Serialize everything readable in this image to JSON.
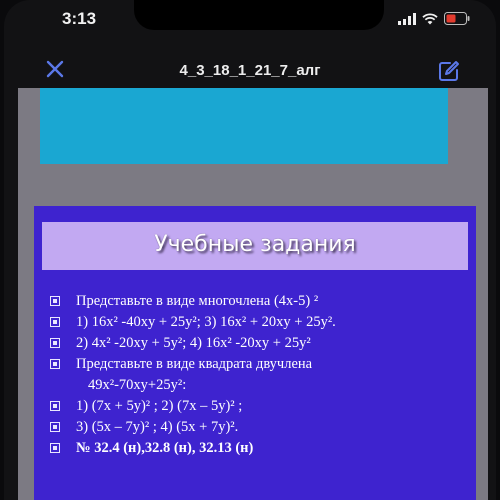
{
  "status_bar": {
    "time": "3:13"
  },
  "nav_bar": {
    "title": "4_3_18_1_21_7_алг"
  },
  "slide": {
    "title": "Учебные задания",
    "items": [
      {
        "text": "Представьте в виде многочлена (4х-5) ²",
        "bullet": true
      },
      {
        "text": "1) 16x² -40xy + 25y²; 3) 16x² + 20xy + 25y².",
        "bullet": true
      },
      {
        "text": "2) 4x² -20xy + 5y²; 4) 16x² -20xy + 25y²",
        "bullet": true
      },
      {
        "text": "Представьте в виде квадрата двучлена",
        "bullet": true
      },
      {
        "text": "49x²-70xy+25y²:",
        "bullet": false
      },
      {
        "text": "1) (7x + 5y)² ; 2) (7x – 5y)² ;",
        "bullet": true
      },
      {
        "text": "3) (5x – 7y)² ; 4) (5x + 7y)².",
        "bullet": true
      },
      {
        "text": "№ 32.4 (н),32.8 (н), 32.13 (н)",
        "bullet": true
      }
    ]
  },
  "colors": {
    "banner": "#1aa7d2",
    "slide_bg": "#3e23cf",
    "slide_header": "#c2a9f2"
  },
  "icons": {
    "close": "close-icon",
    "edit": "edit-icon",
    "signal": "signal-icon",
    "wifi": "wifi-icon",
    "battery": "battery-icon"
  }
}
